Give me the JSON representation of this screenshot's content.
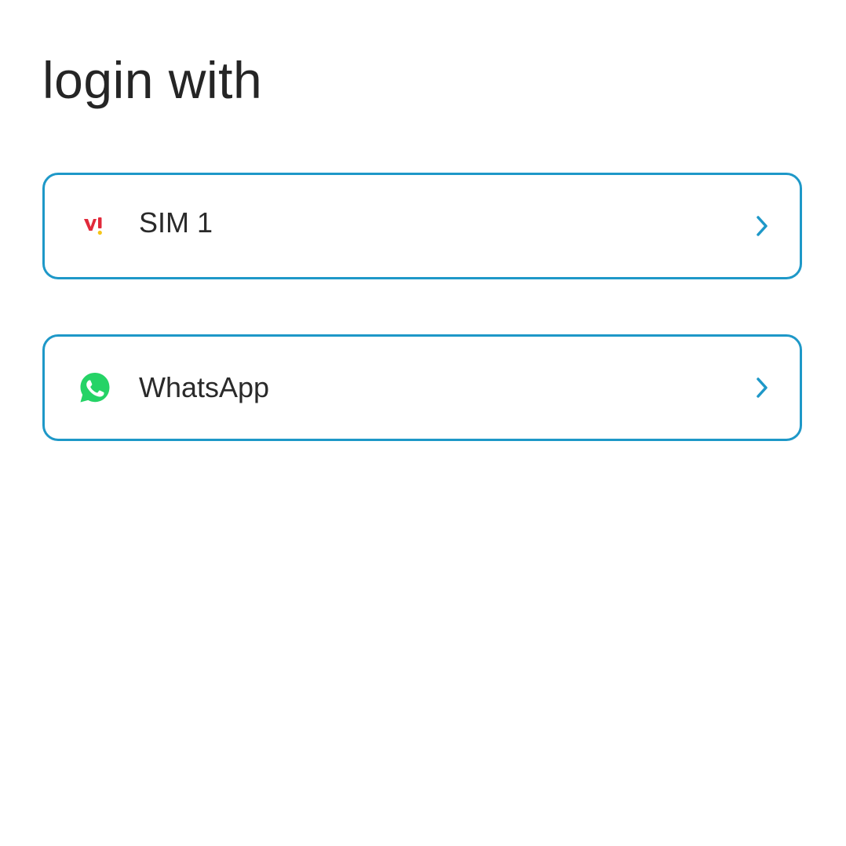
{
  "title": "login with",
  "options": [
    {
      "label": "SIM 1",
      "icon": "vi-logo-icon"
    },
    {
      "label": "WhatsApp",
      "icon": "whatsapp-icon"
    }
  ],
  "colors": {
    "accent": "#1e98c8",
    "text": "#2a2a2a",
    "vi_red": "#e12a3b",
    "vi_yellow": "#f5c518",
    "whatsapp_green": "#25d366"
  }
}
